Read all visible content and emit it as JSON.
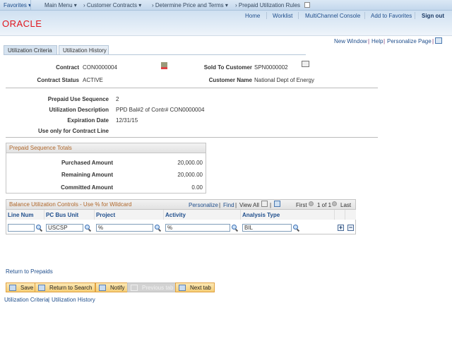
{
  "nav": {
    "favorites": "Favorites",
    "main_menu": "Main Menu",
    "crumbs": [
      "Customer Contracts",
      "Determine Price and Terms",
      "Prepaid Utilization Rules"
    ]
  },
  "header": {
    "links": [
      "Home",
      "Worklist",
      "MultiChannel Console",
      "Add to Favorites"
    ],
    "signout": "Sign out",
    "logo": "ORACLE"
  },
  "pagelinks": {
    "new_window": "New Window",
    "help": "Help",
    "personalize": "Personalize Page"
  },
  "tabs": [
    {
      "label": "Utilization Criteria",
      "active": true
    },
    {
      "label": "Utilization History",
      "active": false
    }
  ],
  "contract": {
    "contract_label": "Contract",
    "contract": "CON0000004",
    "status_label": "Contract Status",
    "status": "ACTIVE",
    "sold_label": "Sold To Customer",
    "sold": "SPN0000002",
    "custname_label": "Customer Name",
    "custname": "National Dept of Energy"
  },
  "prepaid": {
    "seq_label": "Prepaid Use Sequence",
    "seq": "2",
    "desc_label": "Utilization Description",
    "desc": "PPD Bal#2 of Contr# CON0000004",
    "exp_label": "Expiration Date",
    "exp": "12/31/15",
    "line_label": "Use only for Contract Line"
  },
  "totals": {
    "title": "Prepaid Sequence Totals",
    "rows": [
      {
        "label": "Purchased Amount",
        "value": "20,000.00"
      },
      {
        "label": "Remaining Amount",
        "value": "20,000.00"
      },
      {
        "label": "Committed Amount",
        "value": "0.00"
      }
    ]
  },
  "grid": {
    "title": "Balance Utilization Controls - Use % for Wildcard",
    "personalize": "Personalize",
    "find": "Find",
    "view_all": "View All",
    "first": "First",
    "count": "1 of 1",
    "last": "Last",
    "columns": [
      "Line Num",
      "PC Bus Unit",
      "Project",
      "Activity",
      "Analysis Type"
    ],
    "row": {
      "line_num": "",
      "bus_unit": "USCSP",
      "project": "%",
      "activity": "%",
      "analysis_type": "BIL"
    }
  },
  "footer": {
    "return_prepaids": "Return to Prepaids",
    "buttons": [
      "Save",
      "Return to Search",
      "Notify",
      "Previous tab",
      "Next tab"
    ],
    "links": [
      "Utilization Criteria",
      "Utilization History"
    ]
  },
  "colors": {
    "accent": "#1f4e8c",
    "logo": "#e0161e",
    "section_title": "#b0672a",
    "button": "#f5cf78"
  }
}
